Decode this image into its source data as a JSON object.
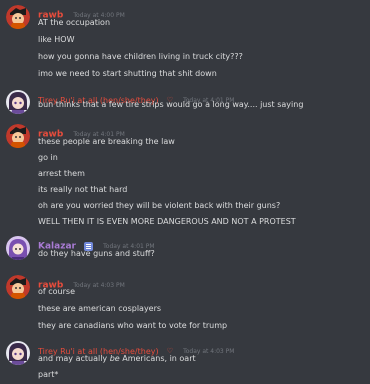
{
  "colors": {
    "background": "#36393f",
    "rawb": "#e74c3c",
    "tirey": "#e74c3c",
    "kalazar": "#a97bd4",
    "timestamp": "#72767d",
    "text": "#dcddde"
  },
  "groups": [
    {
      "username": "rawb",
      "timestamp": "Today at 4:00 PM",
      "avatar": "rawb-avatar",
      "lines": [
        "AT the occupation",
        "like HOW",
        "how you gonna have children living in truck city???",
        "imo we need to start shutting that shit down"
      ]
    },
    {
      "username": "Tirey Ru'i at all (hen/she/they)",
      "timestamp": "Today at 4:01 PM",
      "avatar": "tirey-avatar",
      "lines": [
        "bun thinks that a few tire strips would go a long way.... just saying"
      ]
    },
    {
      "username": "rawb",
      "timestamp": "Today at 4:01 PM",
      "avatar": "rawb-avatar",
      "lines": [
        "these people are breaking the law",
        "go in",
        "arrest them",
        "its really not that hard",
        "oh are you worried they will be violent back with their guns?",
        "WELL THEN IT IS EVEN MORE DANGEROUS AND NOT A PROTEST"
      ]
    },
    {
      "username": "Kalazar",
      "timestamp": "Today at 4:01 PM",
      "avatar": "kalazar-avatar",
      "lines": [
        "do they have guns and stuff?"
      ]
    },
    {
      "username": "rawb",
      "timestamp": "Today at 4:03 PM",
      "avatar": "rawb-avatar",
      "lines": [
        "of course",
        "these are american cosplayers",
        "they are canadians who want to vote for trump"
      ]
    },
    {
      "username": "Tirey Ru'i at all (hen/she/they)",
      "timestamp": "Today at 4:03 PM",
      "avatar": "tirey-avatar",
      "lines": [
        "and may actually ",
        "be",
        " Americans, in oart",
        "part*"
      ]
    }
  ]
}
